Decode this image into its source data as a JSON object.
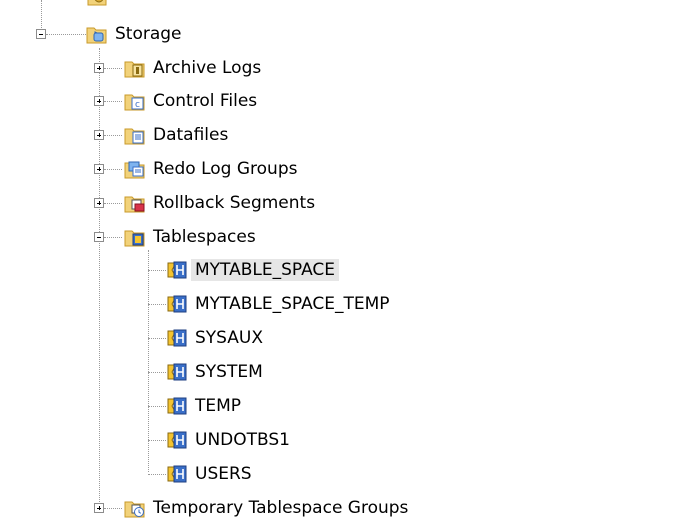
{
  "tree": {
    "storage": {
      "label": "Storage",
      "children": {
        "archive_logs": "Archive Logs",
        "control_files": "Control Files",
        "datafiles": "Datafiles",
        "redo_log_groups": "Redo Log Groups",
        "rollback_segments": "Rollback Segments",
        "tablespaces": {
          "label": "Tablespaces",
          "items": [
            "MYTABLE_SPACE",
            "MYTABLE_SPACE_TEMP",
            "SYSAUX",
            "SYSTEM",
            "TEMP",
            "UNDOTBS1",
            "USERS"
          ],
          "selected": "MYTABLE_SPACE"
        },
        "temporary_tablespace_groups": "Temporary Tablespace Groups"
      }
    }
  },
  "colors": {
    "folder": "#f2d27a",
    "folder_dark": "#c89a2a",
    "tablespace_blue": "#3a6fc8",
    "tablespace_yellow": "#f4c430",
    "selection": "#e6e6e6"
  }
}
